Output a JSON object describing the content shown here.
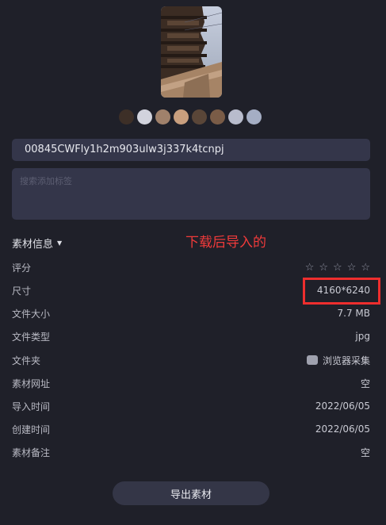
{
  "preview": {
    "swatch_colors": [
      "#3d2f27",
      "#d2d3dd",
      "#a0816b",
      "#c99f7e",
      "#5a4638",
      "#7a5c47",
      "#b8bccc",
      "#a5aec4"
    ]
  },
  "filename": "00845CWFly1h2m903ulw3j337k4tcnpj",
  "tags_placeholder": "搜索添加标签",
  "section_title": "素材信息",
  "annotation": "下载后导入的",
  "info": {
    "rating_label": "评分",
    "size_label": "尺寸",
    "size_value": "4160*6240",
    "filesize_label": "文件大小",
    "filesize_value": "7.7 MB",
    "filetype_label": "文件类型",
    "filetype_value": "jpg",
    "folder_label": "文件夹",
    "folder_value": "浏览器采集",
    "url_label": "素材网址",
    "url_value": "空",
    "import_label": "导入时间",
    "import_value": "2022/06/05",
    "created_label": "创建时间",
    "created_value": "2022/06/05",
    "note_label": "素材备注",
    "note_value": "空"
  },
  "export_button": "导出素材"
}
